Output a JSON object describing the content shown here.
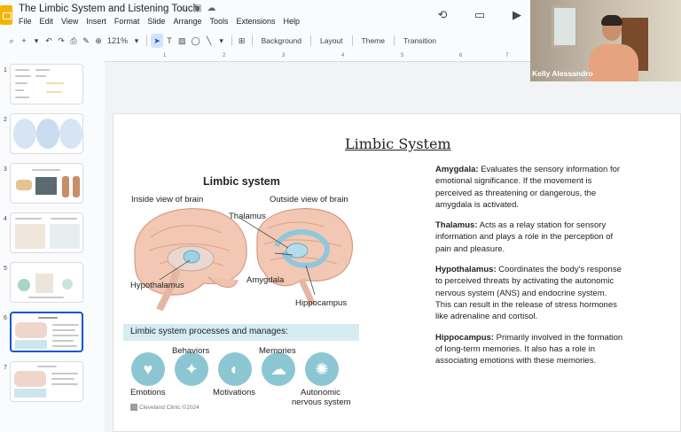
{
  "document": {
    "title": "The Limbic System and Listening Touch"
  },
  "menu": [
    "File",
    "Edit",
    "View",
    "Insert",
    "Format",
    "Slide",
    "Arrange",
    "Tools",
    "Extensions",
    "Help"
  ],
  "toolbar": {
    "zoom": "121%",
    "background_label": "Background",
    "layout_label": "Layout",
    "theme_label": "Theme",
    "transition_label": "Transition"
  },
  "ruler": [
    "1",
    "2",
    "3",
    "4",
    "5",
    "6",
    "7"
  ],
  "filmstrip": {
    "slides": [
      "1",
      "2",
      "3",
      "4",
      "5",
      "6",
      "7"
    ],
    "active": "6"
  },
  "slide": {
    "title": "Limbic System",
    "diagram": {
      "heading": "Limbic system",
      "inside_label": "Inside view of brain",
      "outside_label": "Outside view of brain",
      "thalamus": "Thalamus",
      "hypothalamus": "Hypothalamus",
      "amygdala": "Amygdala",
      "hippocampus": "Hippocampus",
      "processes_banner": "Limbic system processes and manages:",
      "processes": {
        "behaviors": "Behaviors",
        "memories": "Memories",
        "emotions": "Emotions",
        "motivations": "Motivations",
        "autonomic_1": "Autonomic",
        "autonomic_2": "nervous system"
      },
      "credit": "Cleveland Clinic ©2024"
    },
    "definitions": [
      {
        "term": "Amygdala:",
        "text": " Evaluates the sensory information for emotional significance. If the movement is perceived as threatening or dangerous, the amygdala is activated."
      },
      {
        "term": "Thalamus:",
        "text": " Acts as a relay station for sensory information and plays a role in the perception of pain and pleasure."
      },
      {
        "term": "Hypothalamus:",
        "text": " Coordinates the body's response to perceived threats by activating the autonomic nervous system (ANS) and endocrine system. This can result in the release of stress hormones like adrenaline and cortisol."
      },
      {
        "term": "Hippocampus:",
        "text": " Primarily involved in the formation of long-term memories. It also has a role in associating emotions with these memories."
      }
    ]
  },
  "video": {
    "participant": "Kelly Alessandro"
  }
}
